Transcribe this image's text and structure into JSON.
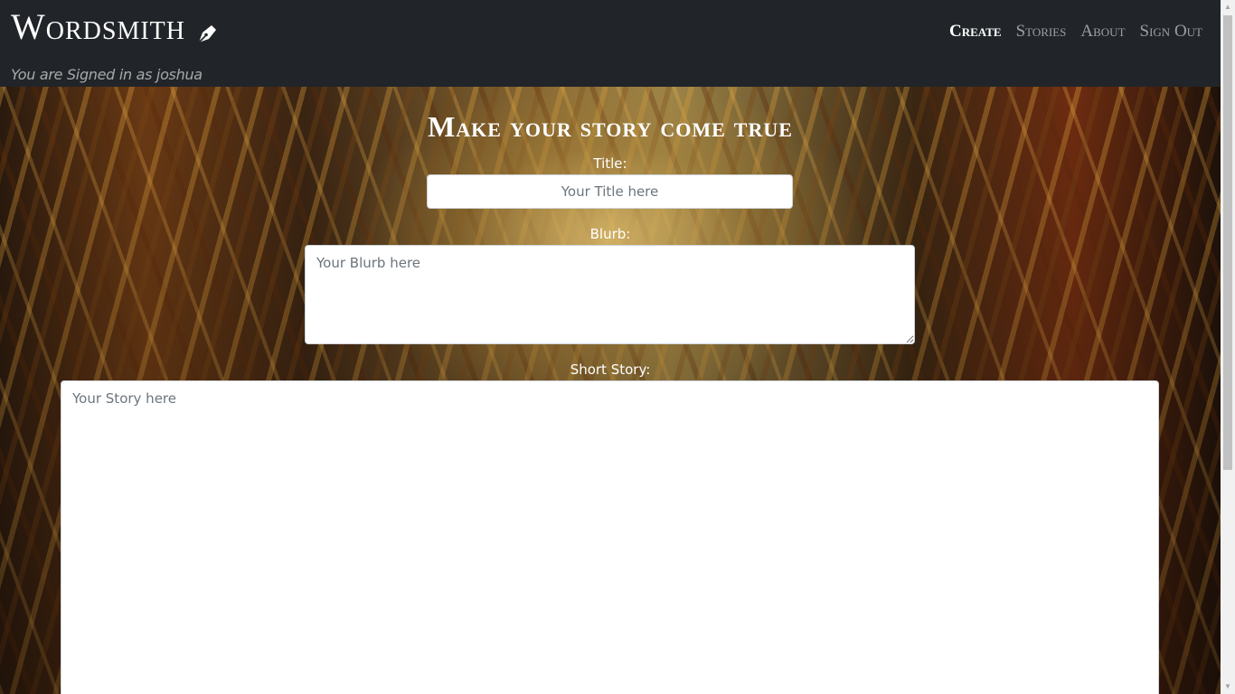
{
  "brand": {
    "name": "Wordsmith",
    "icon": "fountain-pen-icon"
  },
  "nav": {
    "items": [
      {
        "label": "Create",
        "active": true
      },
      {
        "label": "Stories",
        "active": false
      },
      {
        "label": "About",
        "active": false
      },
      {
        "label": "Sign Out",
        "active": false
      }
    ]
  },
  "user": {
    "signed_in_text": "You are Signed in as joshua"
  },
  "form": {
    "heading": "Make your story come true",
    "title_label": "Title:",
    "title_placeholder": "Your Title here",
    "blurb_label": "Blurb:",
    "blurb_placeholder": "Your Blurb here",
    "story_label": "Short Story:",
    "story_placeholder": "Your Story here"
  },
  "colors": {
    "navbar": "#212529",
    "active_nav": "#ffffff",
    "inactive_nav": "rgba(255,255,255,0.55)"
  }
}
